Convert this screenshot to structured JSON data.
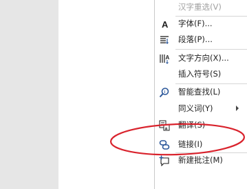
{
  "menu": {
    "items": [
      {
        "label": "汉字重选(V)",
        "icon": "none",
        "disabled": true
      },
      {
        "label": "字体(F)...",
        "icon": "font-icon"
      },
      {
        "label": "段落(P)...",
        "icon": "paragraph-icon"
      },
      {
        "label": "文字方向(X)...",
        "icon": "text-direction-icon"
      },
      {
        "label": "插入符号(S)",
        "icon": "none"
      },
      {
        "label": "智能查找(L)",
        "icon": "smart-lookup-icon"
      },
      {
        "label": "同义词(Y)",
        "icon": "none"
      },
      {
        "label": "翻译(S)",
        "icon": "translate-icon"
      },
      {
        "label": "链接(I)",
        "icon": "link-icon"
      },
      {
        "label": "新建批注(M)",
        "icon": "new-comment-icon"
      }
    ]
  },
  "colors": {
    "annotation_ellipse": "#d9232d",
    "icon_blue": "#2b579a",
    "text": "#1e1e1e",
    "disabled_text": "#a0a0a0"
  }
}
